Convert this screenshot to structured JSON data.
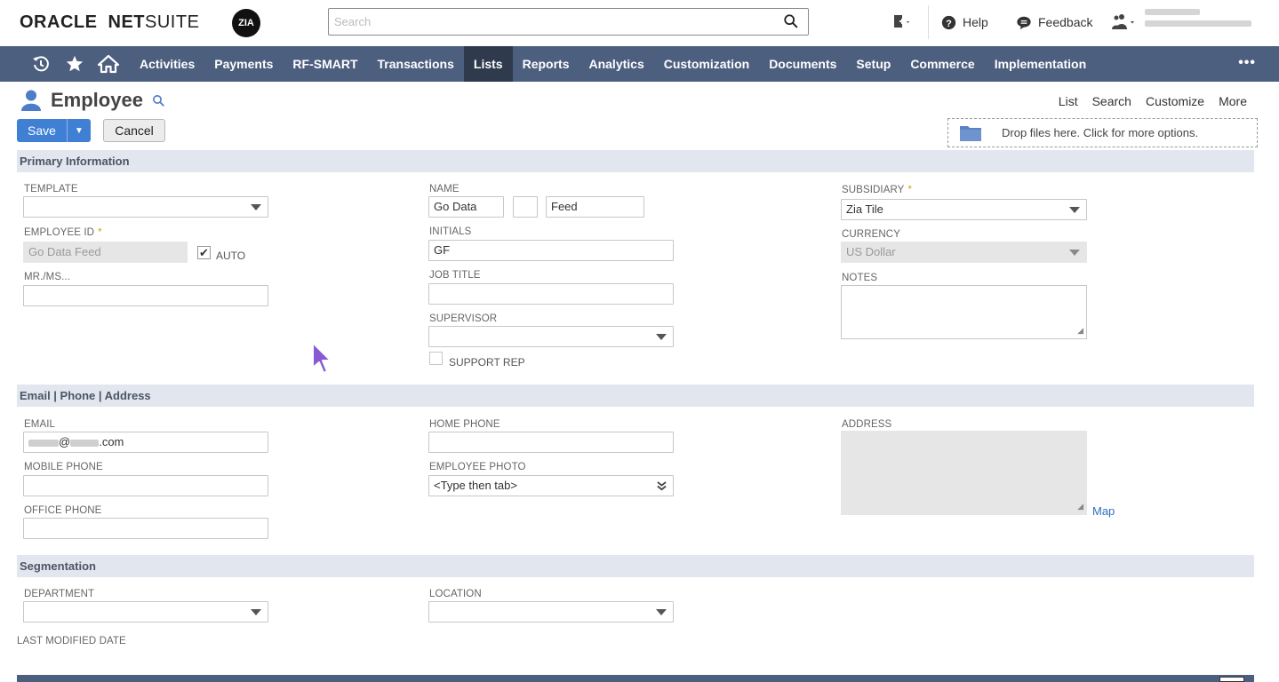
{
  "header": {
    "brand_oracle": "ORACLE",
    "brand_net": "NET",
    "brand_suite": "SUITE",
    "company_logo": "ZIA",
    "search_placeholder": "Search",
    "help_label": "Help",
    "feedback_label": "Feedback"
  },
  "nav": {
    "items": [
      "Activities",
      "Payments",
      "RF-SMART",
      "Transactions",
      "Lists",
      "Reports",
      "Analytics",
      "Customization",
      "Documents",
      "Setup",
      "Commerce",
      "Implementation"
    ],
    "active": "Lists",
    "more": "•••"
  },
  "page": {
    "title": "Employee",
    "links": [
      "List",
      "Search",
      "Customize",
      "More"
    ],
    "save_label": "Save",
    "cancel_label": "Cancel",
    "dropzone_text": "Drop files here. Click for more options."
  },
  "sections": {
    "primary": "Primary Information",
    "contact": "Email | Phone | Address",
    "segmentation": "Segmentation"
  },
  "primary": {
    "template_label": "TEMPLATE",
    "template_value": "",
    "employee_id_label": "EMPLOYEE ID",
    "employee_id_value": "Go Data  Feed",
    "auto_label": "AUTO",
    "auto_checked": true,
    "mrms_label": "MR./MS...",
    "mrms_value": "",
    "name_label": "NAME",
    "name_first": "Go Data",
    "name_middle": "",
    "name_last": "Feed",
    "initials_label": "INITIALS",
    "initials_value": "GF",
    "job_title_label": "JOB TITLE",
    "job_title_value": "",
    "supervisor_label": "SUPERVISOR",
    "supervisor_value": "",
    "support_rep_label": "SUPPORT REP",
    "support_rep_checked": false,
    "subsidiary_label": "SUBSIDIARY",
    "subsidiary_value": "Zia Tile",
    "currency_label": "CURRENCY",
    "currency_value": "US Dollar",
    "notes_label": "NOTES"
  },
  "contact": {
    "email_label": "EMAIL",
    "email_at": "@",
    "email_suffix": ".com",
    "mobile_label": "MOBILE PHONE",
    "office_label": "OFFICE PHONE",
    "home_phone_label": "HOME PHONE",
    "photo_label": "EMPLOYEE PHOTO",
    "photo_value": "<Type then tab>",
    "address_label": "ADDRESS",
    "map_label": "Map"
  },
  "segmentation": {
    "department_label": "DEPARTMENT",
    "location_label": "LOCATION",
    "last_modified_label": "LAST MODIFIED DATE"
  },
  "icons": {
    "recent": "clock-icon",
    "favorites": "star-icon",
    "home": "home-icon",
    "search": "search-icon",
    "employee": "person-icon"
  },
  "colors": {
    "nav_bg": "#4d5f7f",
    "nav_active": "#2f3a4d",
    "save_blue": "#3f7fd4",
    "section_bg": "#e2e6ee",
    "required": "#d4a017"
  }
}
